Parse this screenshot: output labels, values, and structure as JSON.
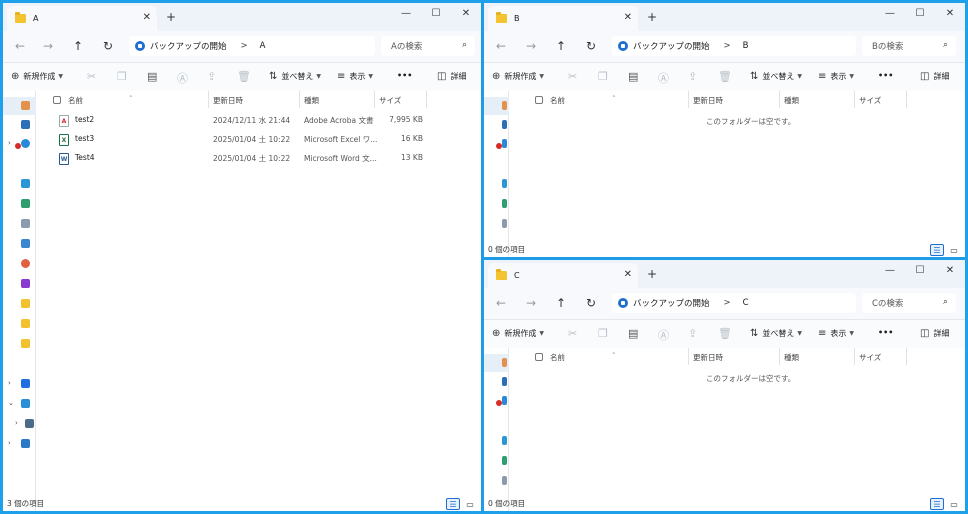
{
  "common": {
    "breadcrumb_root": "バックアップの開始",
    "breadcrumb_sep": ">",
    "new_label": "新規作成",
    "sort_label": "並べ替え",
    "view_label": "表示",
    "more_label": "•••",
    "details_label": "詳細",
    "col_name": "名前",
    "col_date": "更新日時",
    "col_type": "種類",
    "col_size": "サイズ",
    "empty_text": "このフォルダーは空です。",
    "new_tab": "+",
    "tab_close": "✕",
    "minimize": "—",
    "maximize": "☐",
    "close": "✕"
  },
  "windows": {
    "a": {
      "tab_title": "A",
      "breadcrumb_current": "A",
      "search_placeholder": "Aの検索",
      "status": "3 個の項目",
      "files": [
        {
          "name": "test2",
          "date": "2024/12/11 水 21:44",
          "type": "Adobe Acroba 文書",
          "size": "7,995 KB",
          "icon": "pdf-icon",
          "color": "#d62b2b"
        },
        {
          "name": "test3",
          "date": "2025/01/04 土 10:22",
          "type": "Microsoft Excel ワ...",
          "size": "16 KB",
          "icon": "excel-icon",
          "color": "#1e7145"
        },
        {
          "name": "Test4",
          "date": "2025/01/04 土 10:22",
          "type": "Microsoft Word 文...",
          "size": "13 KB",
          "icon": "word-icon",
          "color": "#2b579a"
        }
      ]
    },
    "b": {
      "tab_title": "B",
      "breadcrumb_current": "B",
      "search_placeholder": "Bの検索",
      "status": "0 個の項目"
    },
    "c": {
      "tab_title": "C",
      "breadcrumb_current": "C",
      "search_placeholder": "Cの検索",
      "status": "0 個の項目"
    }
  }
}
